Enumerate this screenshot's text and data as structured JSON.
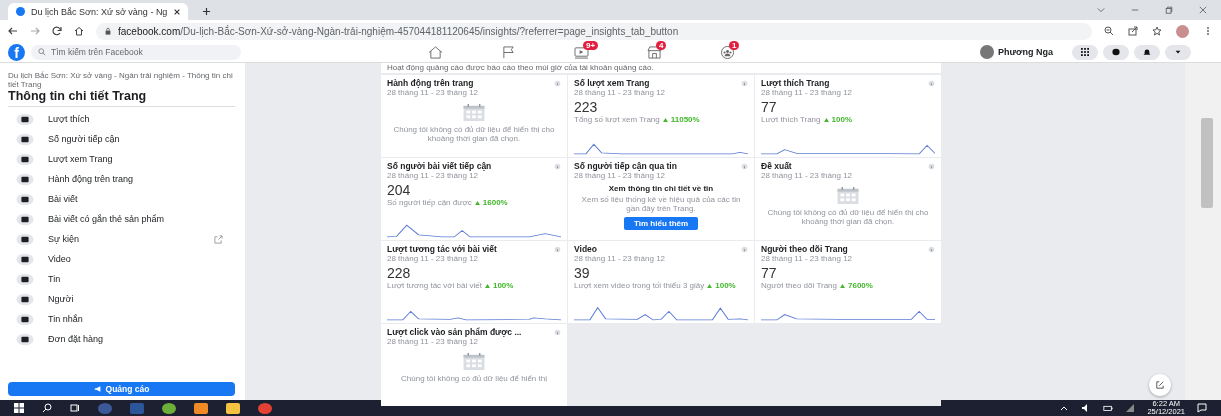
{
  "browser": {
    "tab_title": "Du lịch Bắc Sơn: Xứ sở vàng - Ng",
    "url_host": "facebook.com",
    "url_path": "/Du-lịch-Bắc-Sơn-Xứ-sở-vàng-Ngàn-trải-nghiệm-457044181120645/insights/?referrer=page_insights_tab_button"
  },
  "header": {
    "logo": "f",
    "search_placeholder": "Tìm kiếm trên Facebook",
    "nav": [
      {
        "kind": "home"
      },
      {
        "kind": "flag"
      },
      {
        "kind": "video",
        "badge": "9+"
      },
      {
        "kind": "store",
        "badge": "4"
      },
      {
        "kind": "groups",
        "badge": "1"
      }
    ],
    "user": "Phương Nga"
  },
  "sidebar": {
    "breadcrumb": "Du lịch Bắc Sơn: Xứ sở vàng - Ngàn trải nghiệm - Thông tin chi tiết Trang",
    "title": "Thông tin chi tiết Trang",
    "items": [
      {
        "label": "Lượt thích",
        "external": false
      },
      {
        "label": "Số người tiếp cận",
        "external": false
      },
      {
        "label": "Lượt xem Trang",
        "external": false
      },
      {
        "label": "Hành động trên trang",
        "external": false
      },
      {
        "label": "Bài viết",
        "external": false
      },
      {
        "label": "Bài viết có gắn thẻ sản phẩm",
        "external": false
      },
      {
        "label": "Sự kiện",
        "external": true
      },
      {
        "label": "Video",
        "external": false
      },
      {
        "label": "Tin",
        "external": false
      },
      {
        "label": "Người",
        "external": false
      },
      {
        "label": "Tin nhắn",
        "external": false
      },
      {
        "label": "Đơn đặt hàng",
        "external": false
      }
    ],
    "ad_button": "Quảng cáo"
  },
  "note": "Hoạt động quảng cáo được báo cáo theo múi giờ của tài khoản quảng cáo.",
  "cards": [
    {
      "kind": "empty",
      "title": "Hành động trên trang",
      "date": "28 tháng 11 - 23 tháng 12",
      "message": "Chúng tôi không có đủ dữ liệu để hiển thị cho khoảng thời gian đã chọn."
    },
    {
      "kind": "stat",
      "title": "Số lượt xem Trang",
      "date": "28 tháng 11 - 23 tháng 12",
      "value": "223",
      "caption": "Tổng số lượt xem Trang",
      "trend": "11050%"
    },
    {
      "kind": "stat",
      "title": "Lượt thích Trang",
      "date": "28 tháng 11 - 23 tháng 12",
      "value": "77",
      "caption": "Lượt thích Trang",
      "trend": "100%"
    },
    {
      "kind": "stat",
      "title": "Số người bài viết tiếp cận",
      "date": "28 tháng 11 - 23 tháng 12",
      "value": "204",
      "caption": "Số người tiếp cận được",
      "trend": "1600%"
    },
    {
      "kind": "promo",
      "title": "Số người tiếp cận qua tin",
      "date": "28 tháng 11 - 23 tháng 12",
      "heading": "Xem thông tin chi tiết về tin",
      "message": "Xem số liệu thống kê về hiệu quả của các tin gần đây trên Trang.",
      "button": "Tìm hiểu thêm"
    },
    {
      "kind": "empty",
      "title": "Đề xuất",
      "date": "28 tháng 11 - 23 tháng 12",
      "message": "Chúng tôi không có đủ dữ liệu để hiển thị cho khoảng thời gian đã chọn."
    },
    {
      "kind": "stat",
      "title": "Lượt tương tác với bài viết",
      "date": "28 tháng 11 - 23 tháng 12",
      "value": "228",
      "caption": "Lượt tương tác với bài viết",
      "trend": "100%"
    },
    {
      "kind": "stat",
      "title": "Video",
      "date": "28 tháng 11 - 23 tháng 12",
      "value": "39",
      "caption": "Lượt xem video trong tối thiểu 3 giây",
      "trend": "100%"
    },
    {
      "kind": "stat",
      "title": "Người theo dõi Trang",
      "date": "28 tháng 11 - 23 tháng 12",
      "value": "77",
      "caption": "Người theo dõi Trang",
      "trend": "7600%"
    },
    {
      "kind": "empty",
      "title": "Lượt click vào sản phẩm được ...",
      "date": "28 tháng 11 - 23 tháng 12",
      "message": "Chúng tôi không có đủ dữ liệu để hiển thị"
    }
  ],
  "taskbar": {
    "time": "6:22 AM",
    "date": "25/12/2021"
  }
}
